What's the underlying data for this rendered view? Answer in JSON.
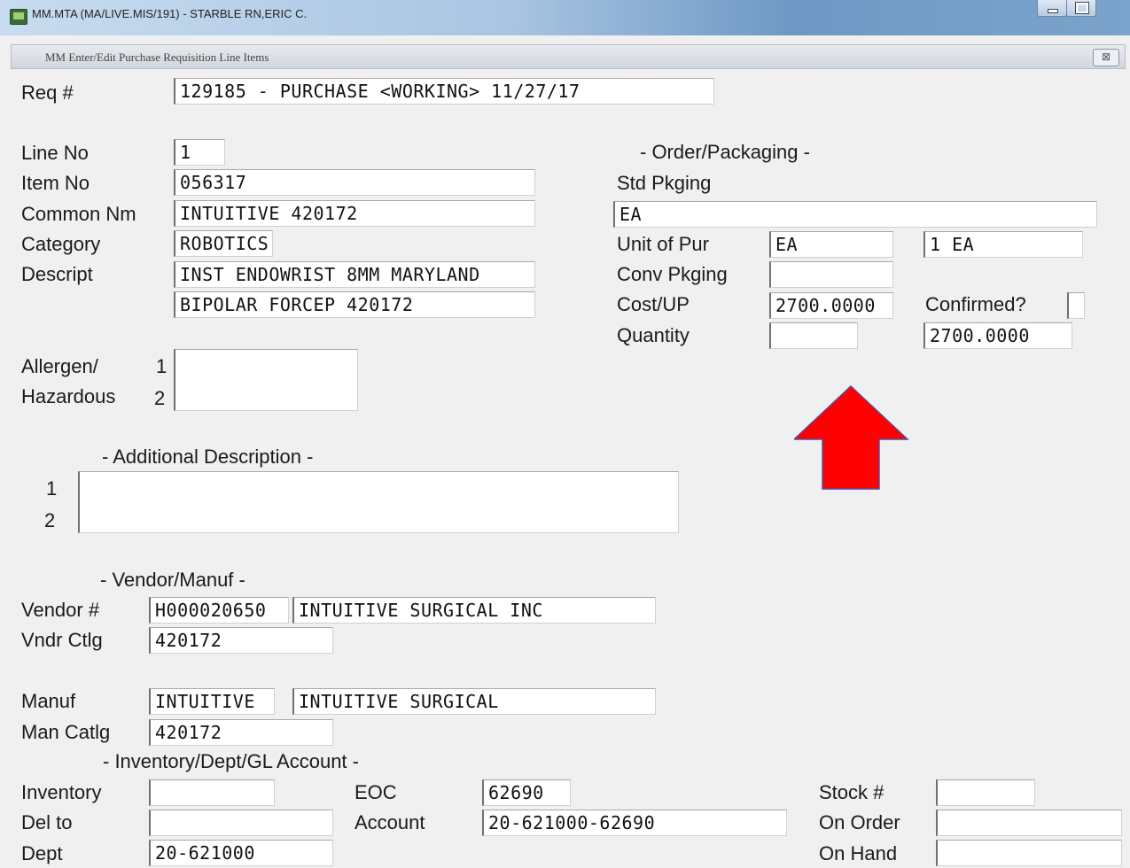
{
  "window": {
    "title": "MM.MTA (MA/LIVE.MIS/191) - STARBLE RN,ERIC C."
  },
  "dialog": {
    "title": "MM  Enter/Edit Purchase Requisition Line Items",
    "close_glyph": "⊠"
  },
  "req": {
    "label": "Req #",
    "value": "129185 - PURCHASE <WORKING> 11/27/17"
  },
  "item": {
    "line_no_label": "Line No",
    "line_no": "1",
    "item_no_label": "Item No",
    "item_no": "056317",
    "common_nm_label": "Common Nm",
    "common_nm": "INTUITIVE 420172",
    "category_label": "Category",
    "category": "ROBOTICS",
    "descript_label": "Descript",
    "descript_1": "INST ENDOWRIST 8MM MARYLAND",
    "descript_2": "BIPOLAR  FORCEP  420172"
  },
  "allergen": {
    "label_1": "Allergen/",
    "label_2": "Hazardous",
    "num_1": "1",
    "num_2": "2",
    "value": ""
  },
  "order": {
    "header": "- Order/Packaging -",
    "std_pkging_label": "Std Pkging",
    "std_pkging": "EA",
    "unit_of_pur_label": "Unit of Pur",
    "unit_of_pur": "EA",
    "unit_of_pur_2": "1 EA",
    "conv_pkging_label": "Conv Pkging",
    "conv_pkging": "",
    "cost_up_label": "Cost/UP",
    "cost_up": "2700.0000",
    "confirmed_label": "Confirmed?",
    "confirmed": "",
    "quantity_label": "Quantity",
    "quantity": "",
    "total": "2700.0000"
  },
  "annotation": {
    "arrow_color": "#ff0000",
    "arrow_icon": "red-up-arrow-icon"
  },
  "additional": {
    "header": "- Additional Description -",
    "num_1": "1",
    "num_2": "2",
    "value": ""
  },
  "vendor": {
    "header": "- Vendor/Manuf -",
    "vendor_no_label": "Vendor #",
    "vendor_no": "H000020650",
    "vendor_name": "INTUITIVE SURGICAL INC",
    "vndr_ctlg_label": "Vndr Ctlg",
    "vndr_ctlg": "420172",
    "manuf_label": "Manuf",
    "manuf_code": "INTUITIVE",
    "manuf_name": "INTUITIVE SURGICAL",
    "man_catlg_label": "Man Catlg",
    "man_catlg": "420172"
  },
  "inventory": {
    "header": "- Inventory/Dept/GL Account -",
    "inventory_label": "Inventory",
    "inventory": "",
    "del_to_label": "Del to",
    "del_to": "",
    "dept_label": "Dept",
    "dept": "20-621000",
    "eoc_label": "EOC",
    "eoc": "62690",
    "account_label": "Account",
    "account": "20-621000-62690",
    "stock_no_label": "Stock #",
    "stock_no": "",
    "on_order_label": "On Order",
    "on_order": "",
    "on_hand_label": "On Hand",
    "on_hand": ""
  }
}
